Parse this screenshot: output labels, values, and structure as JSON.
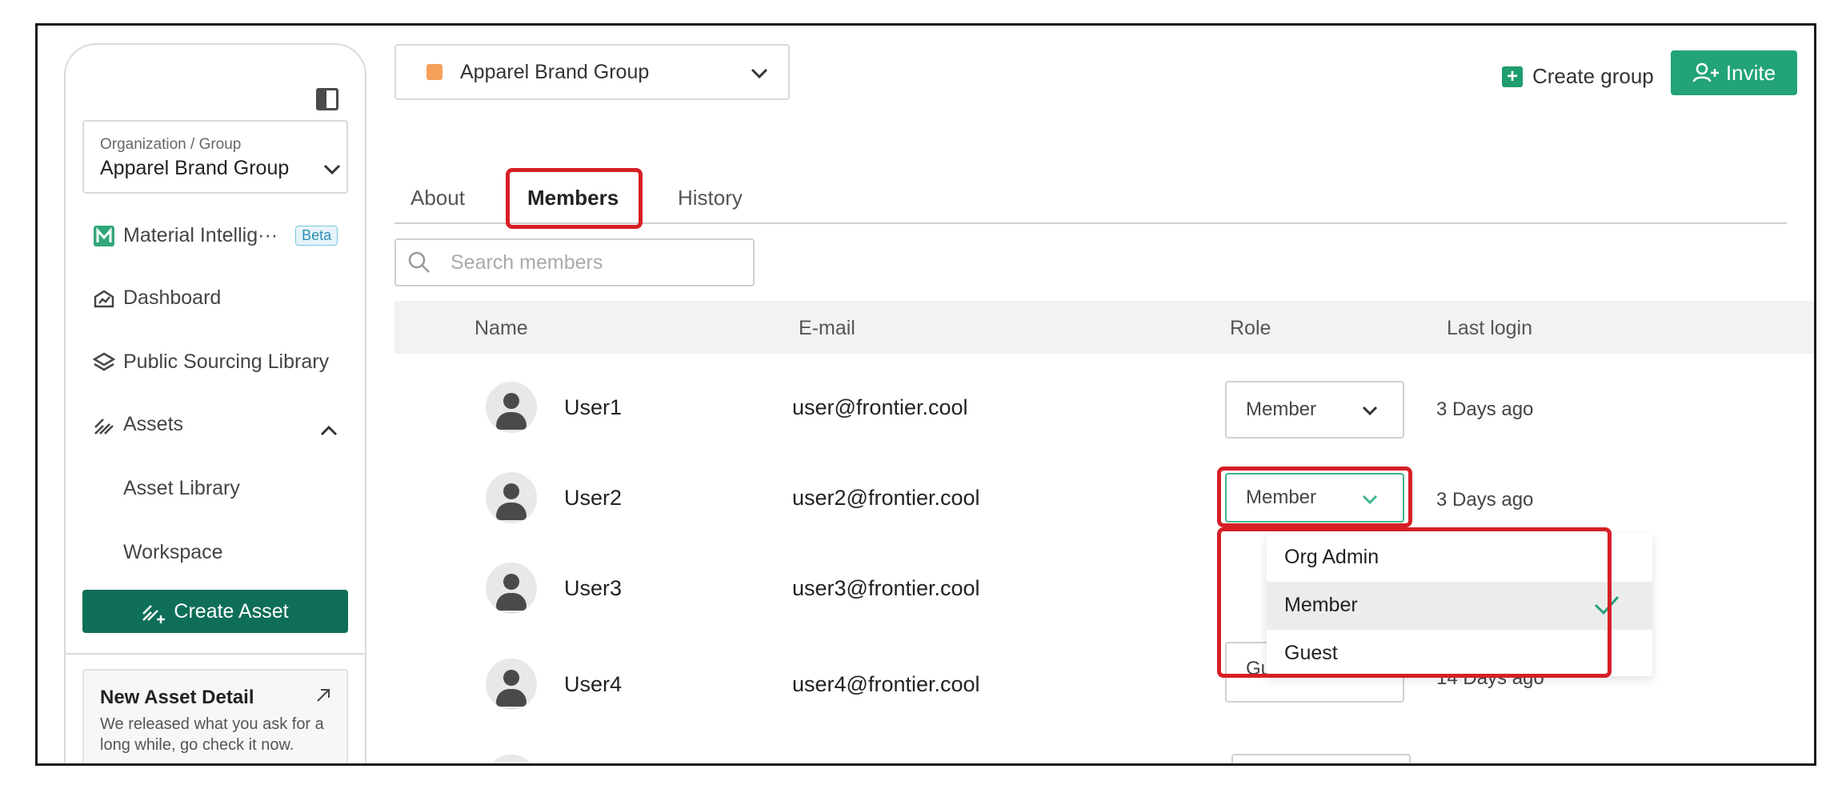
{
  "sidebar": {
    "org_label": "Organization / Group",
    "org_value": "Apparel Brand Group",
    "items": [
      {
        "label": "Material Intellig···",
        "badge": "Beta"
      },
      {
        "label": "Dashboard"
      },
      {
        "label": "Public Sourcing Library"
      },
      {
        "label": "Assets"
      }
    ],
    "sub_items": [
      "Asset Library",
      "Workspace"
    ],
    "create_asset_label": "Create Asset",
    "news": {
      "title": "New Asset Detail",
      "body": "We released what you ask for a long while, go check it now."
    }
  },
  "topbar": {
    "group_name": "Apparel Brand Group",
    "group_color": "#f5a05a",
    "create_group_label": "Create group",
    "invite_label": "Invite"
  },
  "tabs": [
    "About",
    "Members",
    "History"
  ],
  "active_tab": "Members",
  "search": {
    "placeholder": "Search members",
    "value": ""
  },
  "table": {
    "headers": [
      "Name",
      "E-mail",
      "Role",
      "Last login"
    ],
    "rows": [
      {
        "name": "User1",
        "email": "user@frontier.cool",
        "role": "Member",
        "last_login": "3 Days ago"
      },
      {
        "name": "User2",
        "email": "user2@frontier.cool",
        "role": "Member",
        "last_login": "3 Days ago"
      },
      {
        "name": "User3",
        "email": "user3@frontier.cool",
        "role": "",
        "last_login": ""
      },
      {
        "name": "User4",
        "email": "user4@frontier.cool",
        "role": "Guest",
        "last_login": "14 Days ago"
      }
    ]
  },
  "role_dropdown": {
    "options": [
      "Org Admin",
      "Member",
      "Guest"
    ],
    "selected": "Member"
  },
  "colors": {
    "accent": "#23a37a",
    "create_asset_bg": "#0f6e58",
    "highlight": "#d61f26",
    "beta": "#2b8fb3"
  }
}
